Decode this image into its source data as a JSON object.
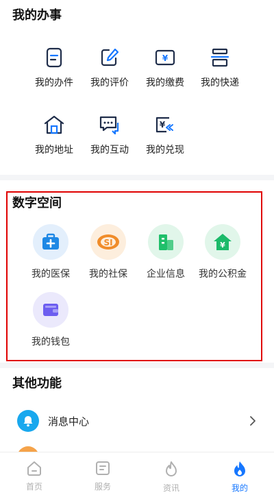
{
  "sections": {
    "my_affairs": {
      "title": "我的办事",
      "items": [
        {
          "label": "我的办件",
          "icon": "document-icon"
        },
        {
          "label": "我的评价",
          "icon": "edit-icon"
        },
        {
          "label": "我的缴费",
          "icon": "yuan-payment-icon"
        },
        {
          "label": "我的快递",
          "icon": "package-icon"
        },
        {
          "label": "我的地址",
          "icon": "home-icon"
        },
        {
          "label": "我的互动",
          "icon": "chat-icon"
        },
        {
          "label": "我的兑现",
          "icon": "redeem-icon"
        }
      ]
    },
    "digital_space": {
      "title": "数字空间",
      "items": [
        {
          "label": "我的医保",
          "icon": "medical-insurance-icon",
          "color": "#1e88e5",
          "bg": "#e3effc"
        },
        {
          "label": "我的社保",
          "icon": "social-security-icon",
          "color": "#f08c2a",
          "bg": "#fdeedd"
        },
        {
          "label": "企业信息",
          "icon": "enterprise-building-icon",
          "color": "#1fbf6a",
          "bg": "#e1f6ea"
        },
        {
          "label": "我的公积金",
          "icon": "housing-fund-icon",
          "color": "#1cba6a",
          "bg": "#e1f6ea"
        },
        {
          "label": "我的钱包",
          "icon": "wallet-icon",
          "color": "#6d5ef0",
          "bg": "#ebe9fc"
        }
      ]
    },
    "other_functions": {
      "title": "其他功能",
      "items": [
        {
          "label": "消息中心",
          "icon": "bell-icon"
        }
      ]
    }
  },
  "tabbar": {
    "tabs": [
      {
        "label": "首页",
        "icon": "home-tab-icon",
        "active": false
      },
      {
        "label": "服务",
        "icon": "service-tab-icon",
        "active": false
      },
      {
        "label": "资讯",
        "icon": "flame-tab-icon",
        "active": false
      },
      {
        "label": "我的",
        "icon": "mine-flame-tab-icon",
        "active": true
      }
    ]
  },
  "colors": {
    "accent": "#1677ff",
    "highlight_border": "#e00000",
    "tab_inactive": "#b0b0b0"
  }
}
